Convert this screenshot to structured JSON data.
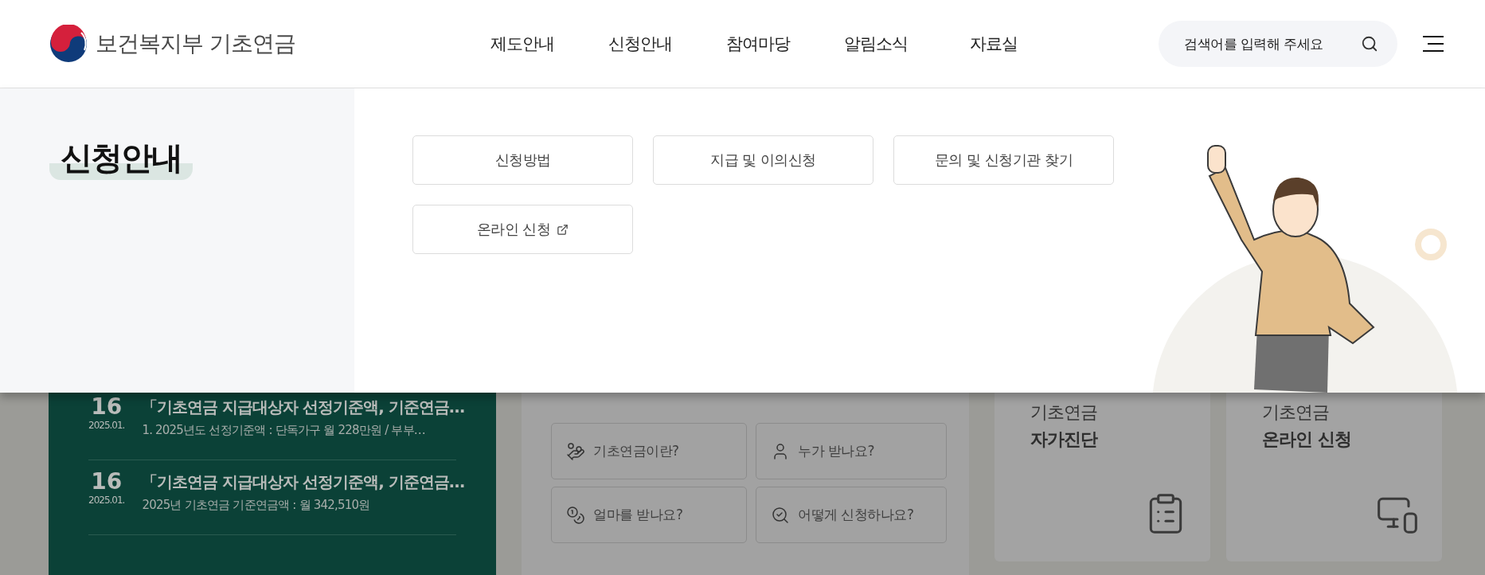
{
  "header": {
    "logo": "보건복지부 기초연금",
    "nav": [
      {
        "label": "제도안내"
      },
      {
        "label": "신청안내"
      },
      {
        "label": "참여마당"
      },
      {
        "label": "알림소식"
      },
      {
        "label": "자료실"
      }
    ],
    "search": {
      "placeholder": "검색어를 입력해 주세요"
    }
  },
  "mega_menu": {
    "title": "신청안내",
    "links": [
      {
        "label": "신청방법",
        "external": false
      },
      {
        "label": "지급 및 이의신청",
        "external": false
      },
      {
        "label": "문의 및 신청기관 찾기",
        "external": false
      },
      {
        "label": "온라인 신청",
        "external": true
      }
    ]
  },
  "news": [
    {
      "day": "16",
      "month": "2025.01.",
      "title": "「기초연금 지급대상자 선정기준액, 기준연금…",
      "summary": "1. 2025년도 선정기준액 : 단독가구 월 228만원 / 부부…"
    },
    {
      "day": "16",
      "month": "2025.01.",
      "title": "「기초연금 지급대상자 선정기준액, 기준연금…",
      "summary": "2025년 기초연금 기준연금액 : 월 342,510원"
    }
  ],
  "quick_links": [
    {
      "label": "기초연금이란?"
    },
    {
      "label": "누가 받나요?"
    },
    {
      "label": "얼마를 받나요?"
    },
    {
      "label": "어떻게 신청하나요?"
    }
  ],
  "cards": [
    {
      "subtitle": "기초연금",
      "title": "자가진단"
    },
    {
      "subtitle": "기초연금",
      "title": "온라인 신청"
    }
  ]
}
